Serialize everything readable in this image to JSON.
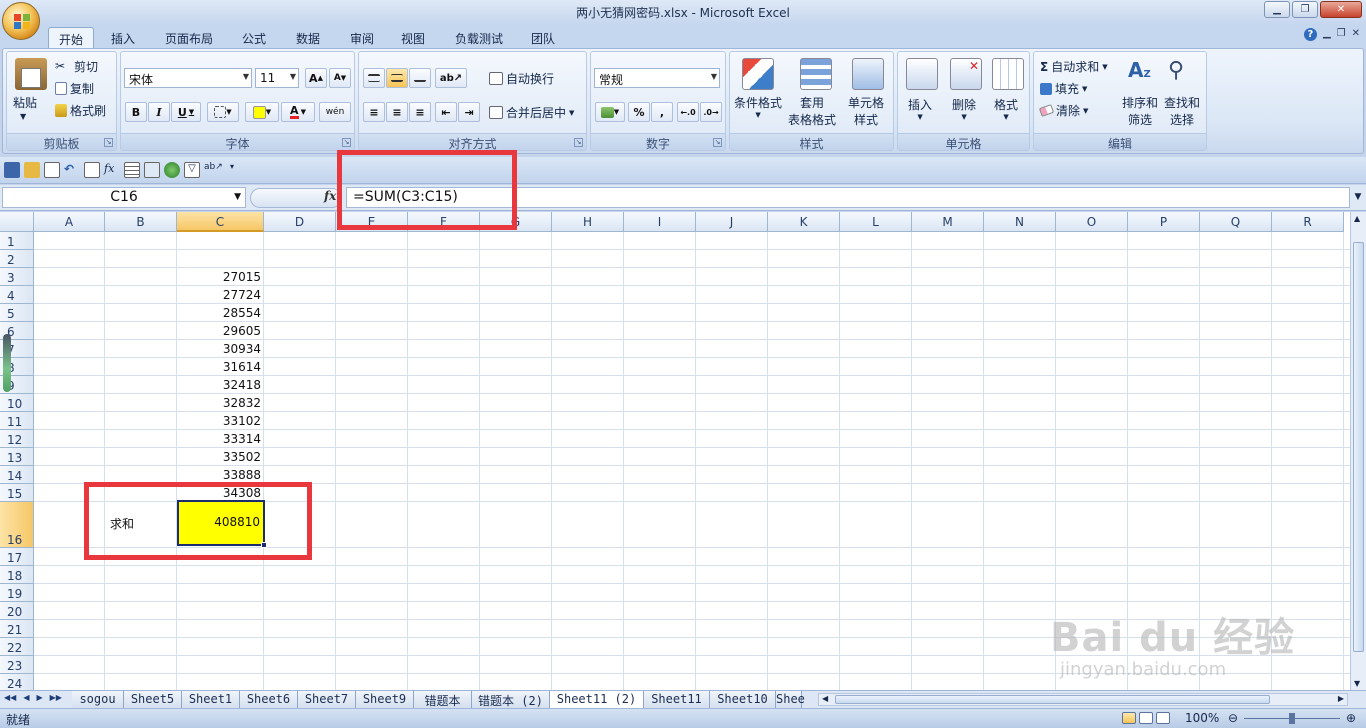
{
  "window": {
    "title": "两小无猜网密码.xlsx - Microsoft Excel"
  },
  "ribbon_tabs": [
    {
      "label": "开始",
      "active": true
    },
    {
      "label": "插入"
    },
    {
      "label": "页面布局"
    },
    {
      "label": "公式"
    },
    {
      "label": "数据"
    },
    {
      "label": "审阅"
    },
    {
      "label": "视图"
    },
    {
      "label": "负载测试"
    },
    {
      "label": "团队"
    }
  ],
  "clipboard": {
    "label": "剪贴板",
    "paste": "粘贴",
    "cut": "剪切",
    "copy": "复制",
    "format_painter": "格式刷"
  },
  "font": {
    "label": "字体",
    "family": "宋体",
    "size": "11",
    "grow": "A",
    "shrink": "A",
    "bold": "B",
    "italic": "I",
    "underline": "U",
    "color_letter": "A",
    "phonetic": "wén"
  },
  "alignment": {
    "label": "对齐方式",
    "wrap": "自动换行",
    "merge": "合并后居中"
  },
  "number": {
    "label": "数字",
    "format": "常规",
    "percent": "%",
    "comma": ","
  },
  "styles": {
    "label": "样式",
    "conditional": "条件格式",
    "table_format_1": "套用",
    "table_format_2": "表格格式",
    "cell_styles_1": "单元格",
    "cell_styles_2": "样式"
  },
  "cells": {
    "label": "单元格",
    "insert": "插入",
    "delete": "删除",
    "format": "格式"
  },
  "editing": {
    "label": "编辑",
    "autosum": "自动求和",
    "fill": "填充",
    "clear": "清除",
    "sort_1": "排序和",
    "sort_2": "筛选",
    "find_1": "查找和",
    "find_2": "选择"
  },
  "formula_bar": {
    "name_box": "C16",
    "fx": "fx",
    "formula": "=SUM(C3:C15)"
  },
  "columns": [
    "A",
    "B",
    "C",
    "D",
    "E",
    "F",
    "G",
    "H",
    "I",
    "J",
    "K",
    "L",
    "M",
    "N",
    "O",
    "P",
    "Q",
    "R"
  ],
  "rows": [
    "1",
    "2",
    "3",
    "4",
    "5",
    "6",
    "7",
    "8",
    "9",
    "10",
    "11",
    "12",
    "13",
    "14",
    "15",
    "16",
    "17",
    "18",
    "19",
    "20",
    "21",
    "22",
    "23",
    "24"
  ],
  "column_c_values": [
    "27015",
    "27724",
    "28554",
    "29605",
    "30934",
    "31614",
    "32418",
    "32832",
    "33102",
    "33314",
    "33502",
    "33888",
    "34308"
  ],
  "sum_label": "求和",
  "sum_value": "408810",
  "sheet_tabs": [
    "sogou",
    "Sheet5",
    "Sheet1",
    "Sheet6",
    "Sheet7",
    "Sheet9",
    "错题本",
    "错题本 (2)",
    "Sheet11 (2)",
    "Sheet11",
    "Sheet10",
    "Shee"
  ],
  "active_sheet": "Sheet11 (2)",
  "status": {
    "ready": "就绪",
    "zoom": "100%"
  },
  "watermark": {
    "main": "Bai du 经验",
    "sub": "jingyan.baidu.com"
  },
  "colors": {
    "selection_fill": "#ffff00",
    "highlight_box": "#e8383d",
    "ribbon": "#dbe7f6"
  }
}
